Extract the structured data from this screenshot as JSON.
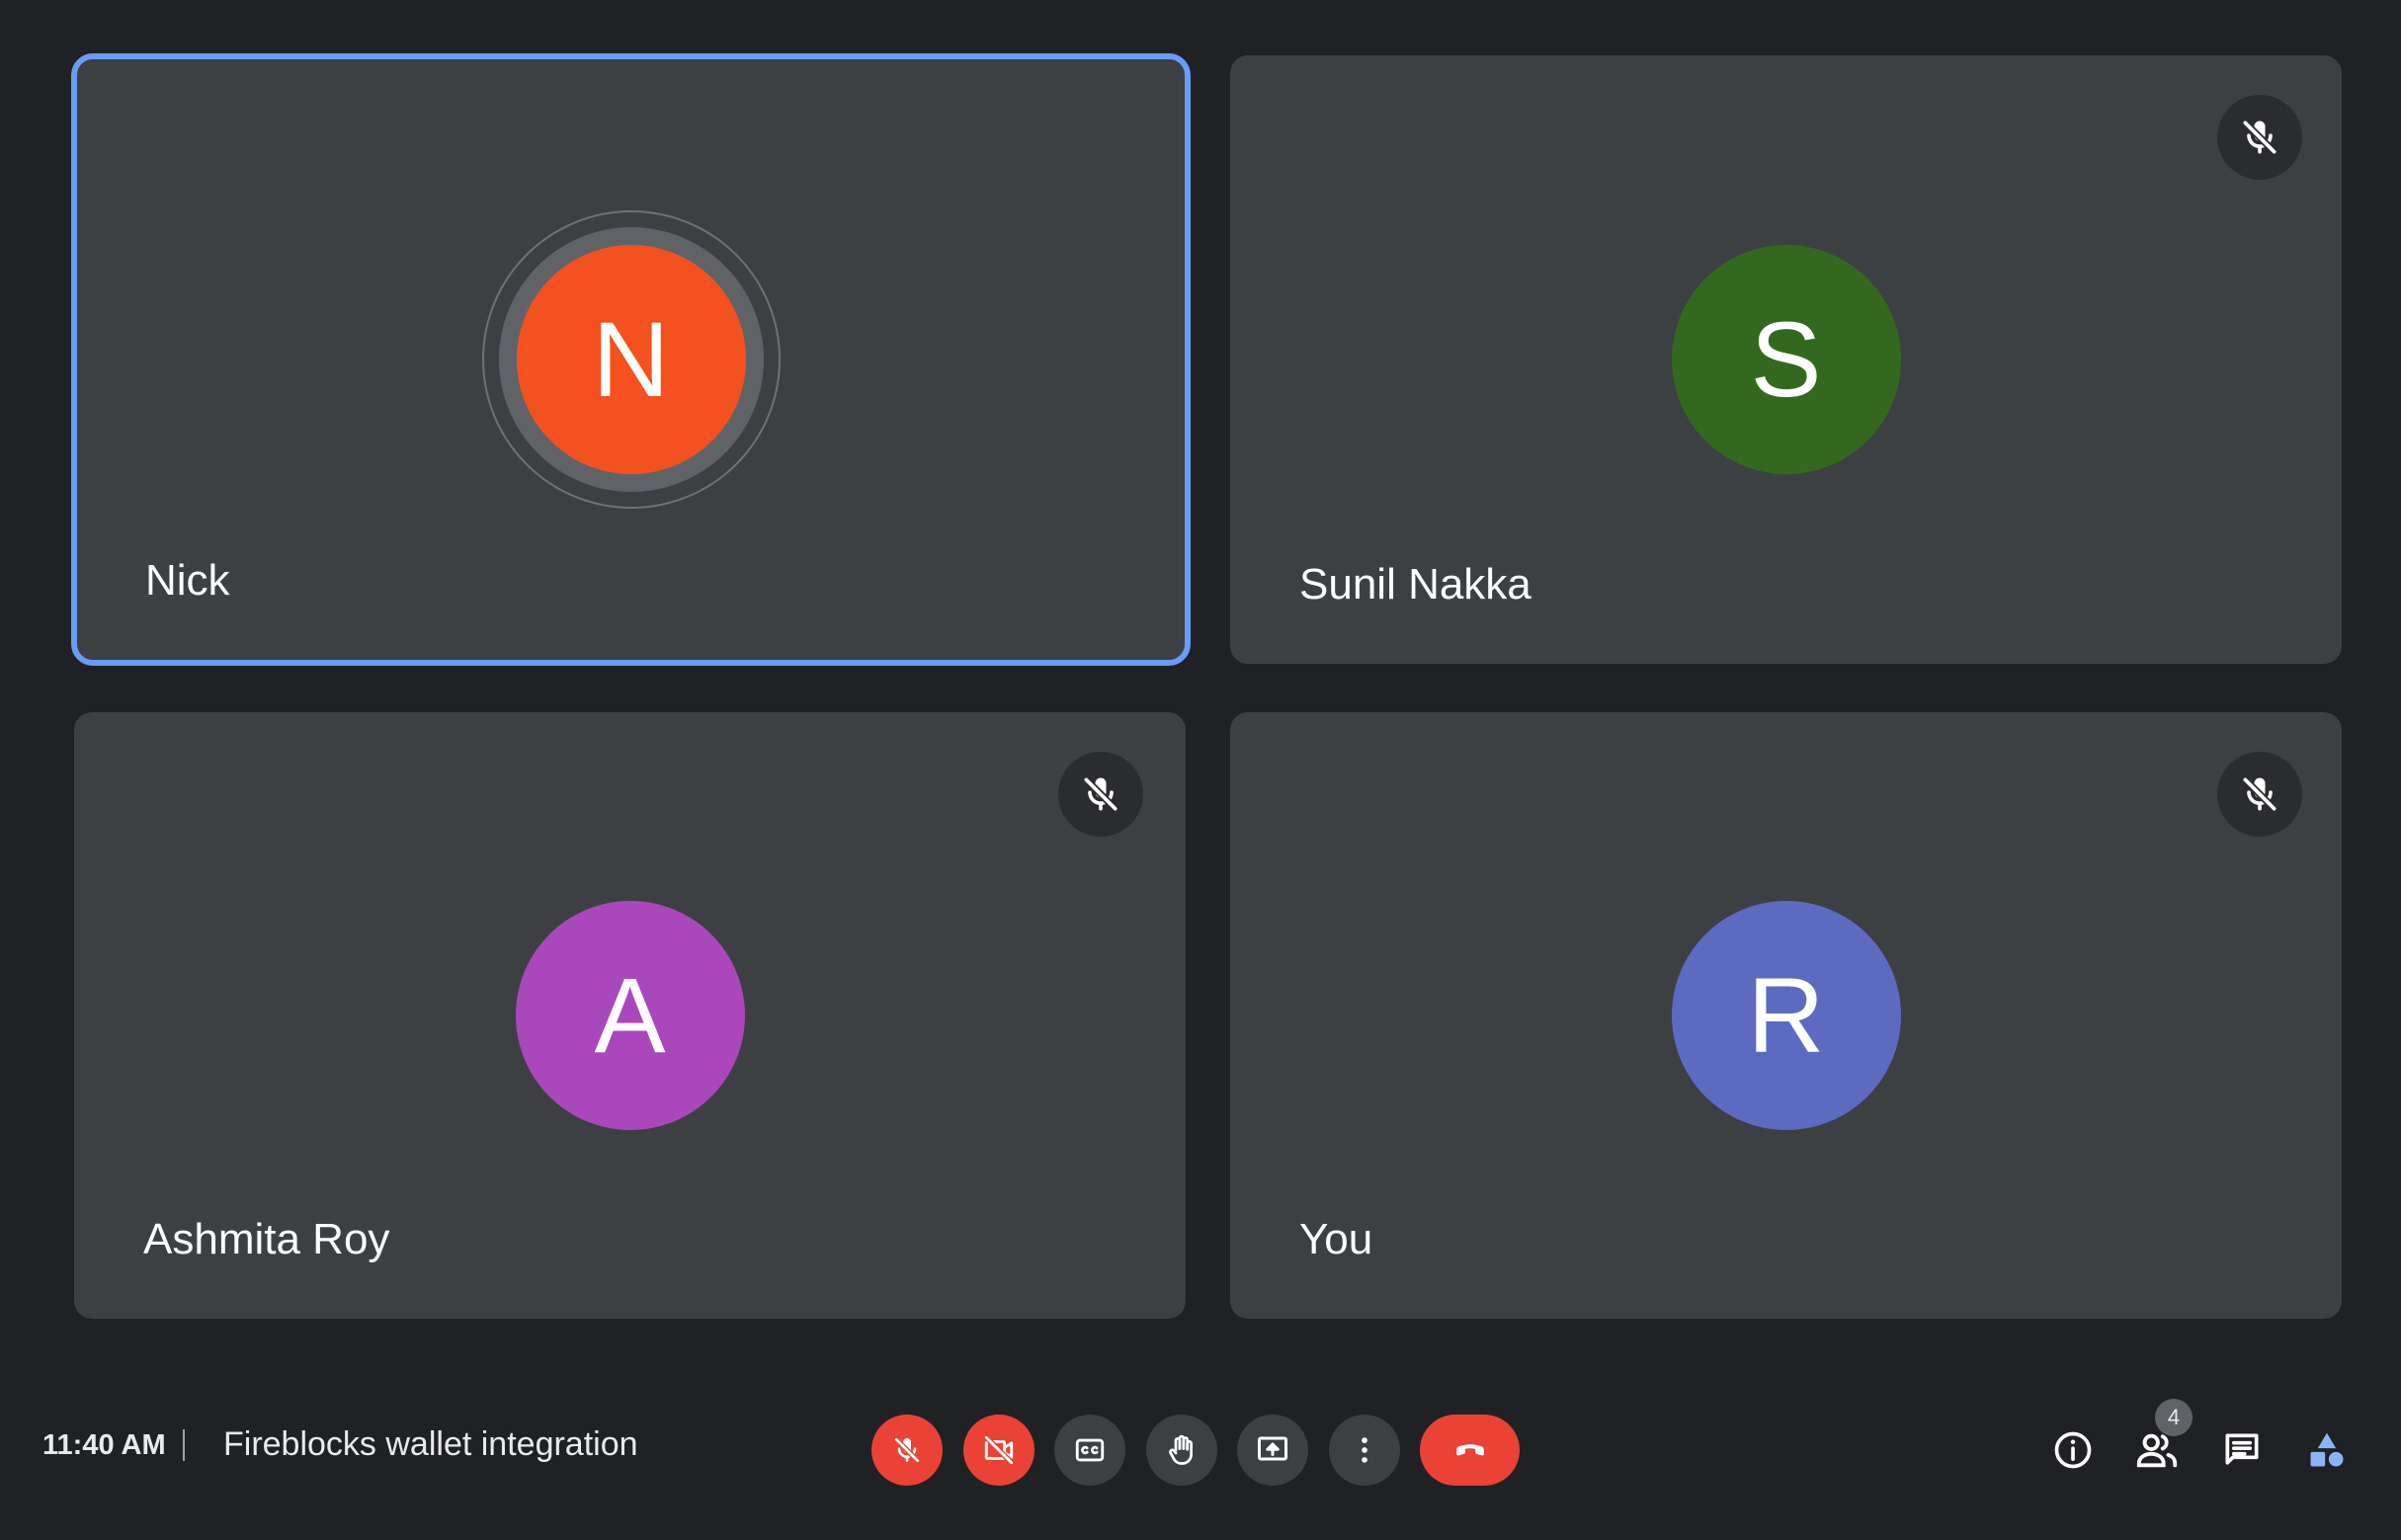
{
  "meeting": {
    "time": "11:40 AM",
    "title": "Fireblocks wallet integration"
  },
  "participants": [
    {
      "name": "Nick",
      "initial": "N",
      "avatar_color": "#f4511e",
      "speaking": true,
      "muted": false,
      "pinned_highlight_color": "#669df6"
    },
    {
      "name": "Sunil Nakka",
      "initial": "S",
      "avatar_color": "#33691e",
      "speaking": false,
      "muted": true
    },
    {
      "name": "Ashmita Roy",
      "initial": "A",
      "avatar_color": "#ab47bc",
      "speaking": false,
      "muted": true
    },
    {
      "name": "You",
      "initial": "R",
      "avatar_color": "#5c6bc0",
      "speaking": false,
      "muted": true
    }
  ],
  "controls": [
    {
      "icon": "mic-off-icon",
      "state": "off",
      "color": "#ea4335"
    },
    {
      "icon": "camera-off-icon",
      "state": "off",
      "color": "#ea4335"
    },
    {
      "icon": "closed-captions-icon"
    },
    {
      "icon": "raise-hand-icon"
    },
    {
      "icon": "present-screen-icon"
    },
    {
      "icon": "more-options-icon"
    },
    {
      "icon": "end-call-icon",
      "color": "#ea4335"
    }
  ],
  "side_panel": {
    "people_count": "4",
    "icons": [
      "meeting-details-icon",
      "people-icon",
      "chat-icon",
      "activities-icon"
    ],
    "activities_color": "#8ab4f8"
  }
}
